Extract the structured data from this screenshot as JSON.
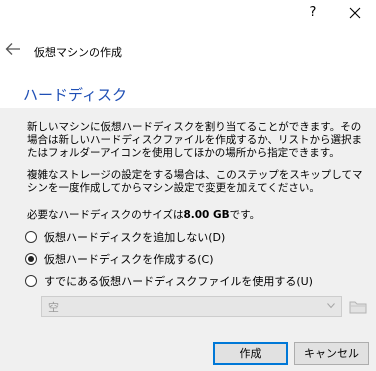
{
  "titlebar": {
    "help_label": "?",
    "close_icon": "close-icon"
  },
  "header": {
    "back_icon": "back-arrow-icon",
    "wizard_title": "仮想マシンの作成",
    "page_heading": "ハードディスク"
  },
  "content": {
    "paragraph1": "新しいマシンに仮想ハードディスクを割り当てることができます。その場合は新しいハードディスクファイルを作成するか、リストから選択またはフォルダーアイコンを使用してほかの場所から指定できます。",
    "paragraph2": "複雑なストレージの設定をする場合は、このステップをスキップしてマシンを一度作成してからマシン設定で変更を加えてください。",
    "size_prefix": "必要なハードディスクのサイズは",
    "size_value": "8.00 GB",
    "size_suffix": "です。",
    "options": [
      {
        "label": "仮想ハードディスクを追加しない(D)",
        "checked": false
      },
      {
        "label": "仮想ハードディスクを作成する(C)",
        "checked": true
      },
      {
        "label": "すでにある仮想ハードディスクファイルを使用する(U)",
        "checked": false
      }
    ],
    "combo_value": "空",
    "folder_icon": "folder-icon"
  },
  "footer": {
    "create_label": "作成",
    "cancel_label": "キャンセル"
  }
}
